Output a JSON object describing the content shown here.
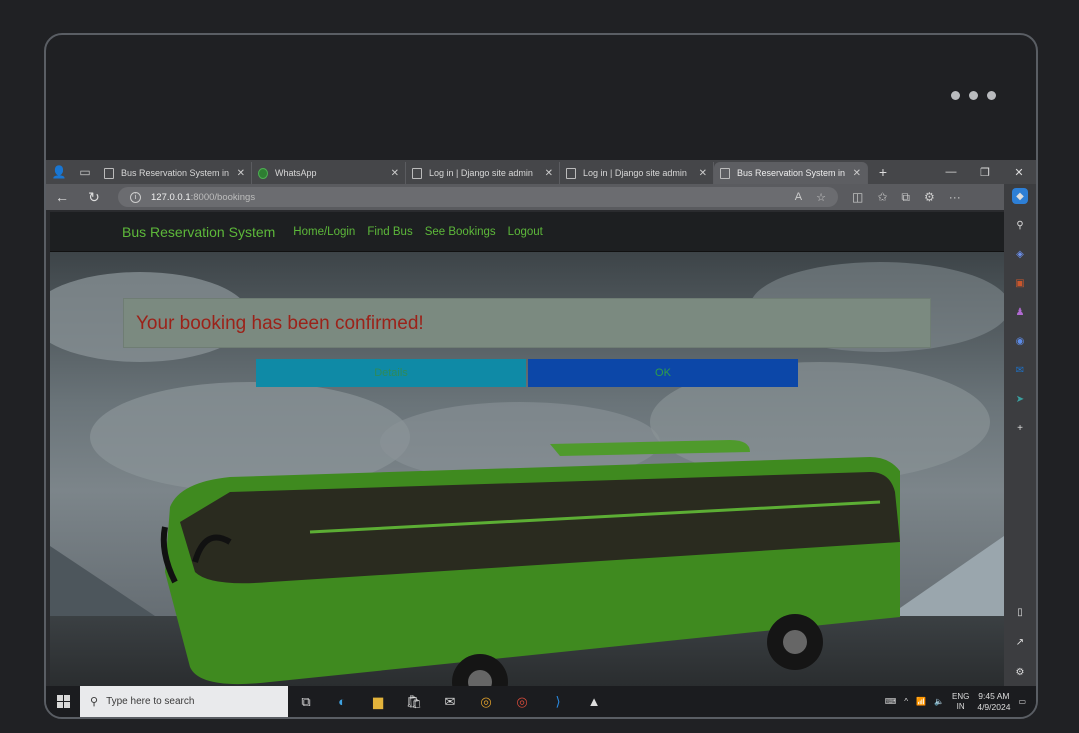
{
  "browser": {
    "tabs": [
      {
        "title": "Bus Reservation System in D",
        "favicon": "page-icon",
        "active": false
      },
      {
        "title": "WhatsApp",
        "favicon": "whatsapp-icon",
        "active": false
      },
      {
        "title": "Log in | Django site admin",
        "favicon": "page-icon",
        "active": false
      },
      {
        "title": "Log in | Django site admin",
        "favicon": "page-icon",
        "active": false
      },
      {
        "title": "Bus Reservation System in D",
        "favicon": "page-icon",
        "active": true
      }
    ],
    "url_host": "127.0.0.1",
    "url_path": ":8000/bookings"
  },
  "site": {
    "brand": "Bus Reservation System",
    "nav": [
      "Home/Login",
      "Find Bus",
      "See Bookings",
      "Logout"
    ],
    "alert_message": "Your booking has been confirmed!",
    "details_label": "Details",
    "ok_label": "OK",
    "colors": {
      "brand_green": "#5db83a",
      "alert_text": "#9b2219",
      "details_btn": "#0f8aa6",
      "ok_btn": "#0c47a8"
    }
  },
  "taskbar": {
    "search_placeholder": "Type here to search",
    "lang_line1": "ENG",
    "lang_line2": "IN",
    "time": "9:45 AM",
    "date": "4/9/2024"
  }
}
